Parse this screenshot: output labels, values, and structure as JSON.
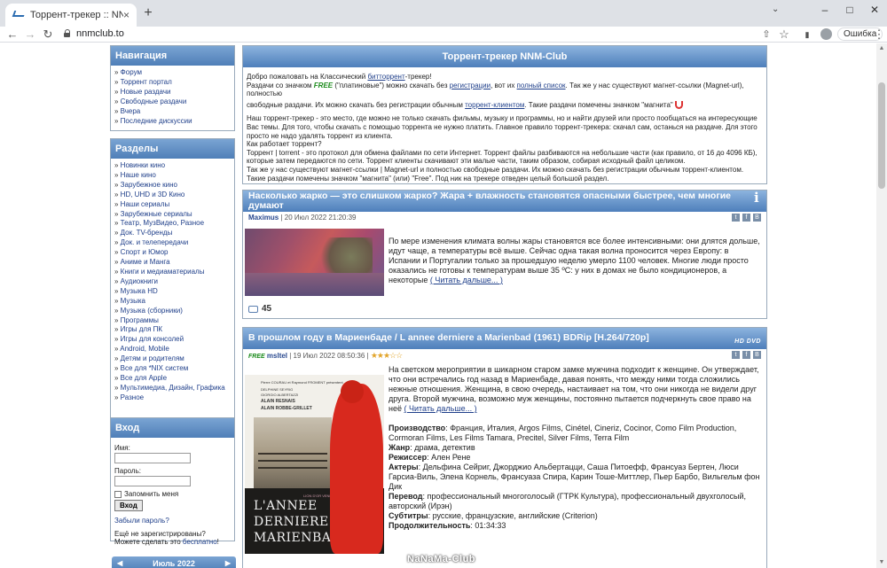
{
  "browser": {
    "tab_title": "Торрент-трекер :: NNM-Club",
    "tab_close": "×",
    "new_tab": "+",
    "url": "nnmclub.to",
    "error_button": "Ошибка",
    "minimize": "–",
    "maximize": "□",
    "close": "✕",
    "tab_menu": "⌄",
    "back": "←",
    "forward": "→",
    "reload": "↻",
    "share": "⇧",
    "bookmark": "☆",
    "sidepanel": "▮",
    "menu": "⋮"
  },
  "sidebar": {
    "nav_title": "Навигация",
    "nav_items": [
      "Форум",
      "Торрент портал",
      "Новые раздачи",
      "Свободные раздачи",
      "Вчера",
      "Последние дискуссии"
    ],
    "sections_title": "Разделы",
    "section_items": [
      "Новинки кино",
      "Наше кино",
      "Зарубежное кино",
      "HD, UHD и 3D Кино",
      "Наши сериалы",
      "Зарубежные сериалы",
      "Театр, МузВидео, Разное",
      "Док. TV-бренды",
      "Док. и телепередачи",
      "Спорт и Юмор",
      "Аниме и Манга",
      "Книги и медиаматериалы",
      "Аудиокниги",
      "Музыка HD",
      "Музыка",
      "Музыка (сборники)",
      "Программы",
      "Игры для ПК",
      "Игры для консолей",
      "Android, Mobile",
      "Детям и родителям",
      "Все для *NIX систем",
      "Все для Apple",
      "Мультимедиа, Дизайн, Графика",
      "Разное"
    ],
    "login_title": "Вход",
    "login_label": "Имя:",
    "password_label": "Пароль:",
    "remember_label": "Запомнить меня",
    "login_button": "Вход",
    "forgot": "Забыли пароль?",
    "not_registered": "Ещё не зарегистрированы?",
    "can_do_prefix": "Можете сделать это ",
    "free_link": "бесплатно",
    "can_do_suffix": "!",
    "calendar_title": "Июль 2022",
    "cal_prev": "◀",
    "cal_next": "▶"
  },
  "welcome": {
    "title": "Торрент-трекер NNM-Club",
    "l1a": "Добро пожаловать на Классический ",
    "l1link": "битторрент",
    "l1b": "-трекер!",
    "l2a": "Раздачи со значком ",
    "free_badge": "FREE",
    "l2b": " (\"платиновые\") можно скачать без ",
    "l2link1": "регистрации",
    "l2c": ", вот их ",
    "l2link2": "полный список",
    "l2d": ". Так же у нас существуют магнет-ссылки (Magnet-url), полностью",
    "l3a": "свободные раздачи. Их можно скачать без регистрации обычным ",
    "l3link": "торрент-клиентом",
    "l3b": ". Такие раздачи помечены значком \"магнита\"",
    "p2": "Наш торрент-трекер - это место, где можно не только скачать фильмы, музыку и программы, но и найти друзей или просто пообщаться на интересующие Вас темы. Для того, чтобы скачать с помощью торрента не нужно платить. Главное правило торрент-трекера: скачал сам, останься на раздаче. Для этого просто не надо удалять торрент из клиента.",
    "p3": "Как работает торрент?",
    "p4": "Торрент | torrent - это протокол для обмена файлами по сети Интернет. Торрент файлы разбиваются на небольшие части (как правило, от 16 до 4096 КБ), которые затем передаются по сети. Торрент клиенты скачивают эти малые части, таким образом, собирая исходный файл целиком.",
    "p5": "Так же у нас существуют магнет-ссылки | Magnet-url и полностью свободные раздачи. Их можно скачать без регистрации обычным торрент-клиентом. Такие раздачи помечены значком \"магнита\" (или) \"Free\". Под ник на трекере отведен целый большой раздел."
  },
  "post1": {
    "title": "Насколько жарко — это слишком жарко? Жара + влажность становятся опасными быстрее, чем многие думают",
    "author": "Maximus",
    "date": " | 20 Июл 2022 21:20:39",
    "text": "По мере изменения климата волны жары становятся все более интенсивными: они длятся дольше, идут чаще, а температуры всё выше. Сейчас одна такая волна проносится через Европу: в Испании и Португалии только за прошедшую неделю умерло 1100 человек. Многие люди просто оказались не готовы к температурам выше 35 ºС: у них в домах не было кондиционеров, а некоторые ",
    "more": "( Читать дальше... )",
    "comments": "45"
  },
  "post2": {
    "title": "В прошлом году в Мариенбаде / L annee derniere a Marienbad (1961) BDRip [H.264/720p]",
    "badge": "HD DVD",
    "free_badge": "FREE",
    "author": "msltel",
    "date": " | 19 Июл 2022 08:50:36 | ",
    "stars": "★★★☆☆",
    "text": "На светском мероприятии в шикарном старом замке мужчина подходит к женщине. Он утверждает, что они встречались год назад в Мариенбаде, давая понять, что между ними тогда сложились нежные отношения. Женщина, в свою очередь, настаивает на том, что они никогда не видели друг друга. Второй мужчина, возможно муж женщины, постоянно пытается подчеркнуть свое право на неё ",
    "more": "( Читать дальше... )",
    "prod_label": "Производство",
    "prod": ": Франция, Италия, Argos Films, Cinétel, Cineriz, Cocinor, Como Film Production, Cormoran Films, Les Films Tamara, Precitel, Silver Films, Terra Film",
    "genre_label": "Жанр",
    "genre": ": драма, детектив",
    "dir_label": "Режиссер",
    "dir": ": Ален Рене",
    "actors_label": "Актеры",
    "actors": ": Дельфина Сейриг, Джорджио Альбертацци, Саша Питоефф, Франсуаз Бертен, Люси Гарсиа-Виль, Элена Корнель, Франсуаза Спира, Карин Тоше-Миттлер, Пьер Барбо, Вильгельм фон Дик",
    "trans_label": "Перевод",
    "trans": ": профессиональный многоголосый (ГТРК Культура), профессиональный двухголосый, авторский (Ирэн)",
    "subs_label": "Субтитры",
    "subs": ": русские, французские, английские (Criterion)",
    "dur_label": "Продолжительность",
    "dur": ": 01:34:33",
    "poster": {
      "l1": "Pierre COURAU et Raymond FROMENT présentent",
      "l2": "DELPHINE SEYRIG",
      "l3": "GIORGIO ALBERTAZZI",
      "l4": "ALAIN RESNAIS",
      "l5": "ALAIN ROBBE-GRILLET",
      "t1": "L'ANNEE",
      "t2": "DERNIERE A",
      "t3": "MARIENBAD",
      "award": "LION D'OR VENISE"
    }
  },
  "watermark": "NaNaMa-Club"
}
